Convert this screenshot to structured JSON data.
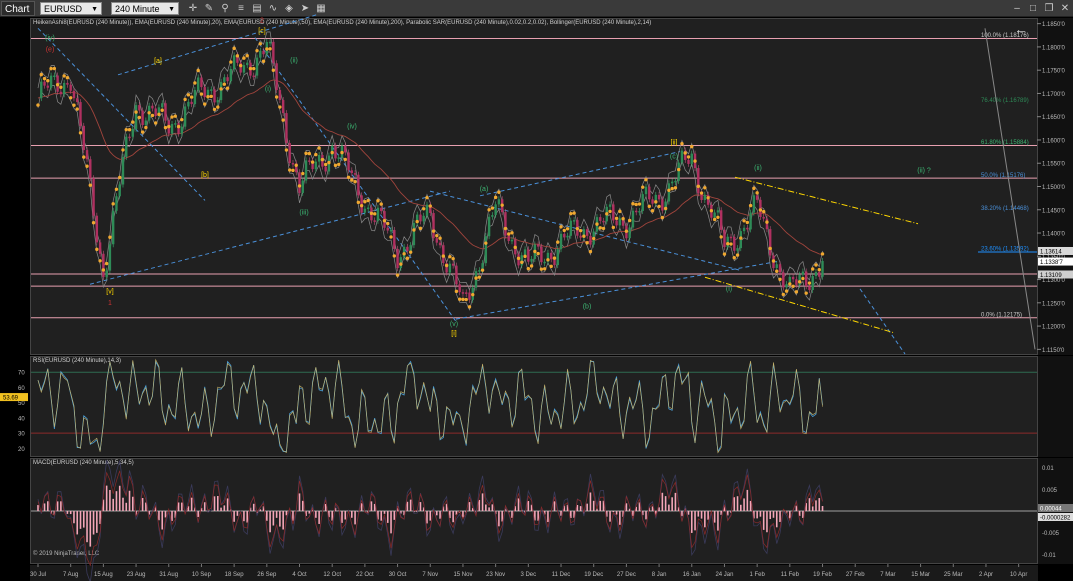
{
  "toolbar": {
    "chart_label": "Chart",
    "instrument": "EURUSD",
    "timeframe": "240 Minute",
    "back_icon": "left-arrow-icon",
    "icons": [
      "crosshair-icon",
      "draw-icon",
      "zoom-icon",
      "properties-icon",
      "template-icon",
      "indicator-icon",
      "strategy-icon",
      "pointer-icon",
      "bar-type-icon"
    ]
  },
  "main_panel": {
    "title": "HeikenAshi8(EURUSD (240 Minute)), EMA(EURUSD (240 Minute),20), EMA(EURUSD (240 Minute),50), EMA(EURUSD (240 Minute),200), Parabolic SAR(EURUSD (240 Minute),0.02,0.2,0.02), Bollinger(EURUSD (240 Minute),2,14)",
    "price_ticks": [
      "1.1850'0",
      "1.1800'0",
      "1.1750'0",
      "1.1700'0",
      "1.1650'0",
      "1.1600'0",
      "1.1550'0",
      "1.1500'0",
      "1.1450'0",
      "1.1400'0",
      "1.1350'0",
      "1.1300'0",
      "1.1250'0",
      "1.1200'0",
      "1.1150'0"
    ],
    "price_flags": [
      {
        "label": "1.13614",
        "color": "#d8d8d8"
      },
      {
        "label": "1.1338'7",
        "color": "#ffffff"
      },
      {
        "label": "1.13109",
        "color": "#cfcfcf"
      }
    ],
    "fib_levels": [
      {
        "label": "100.0% (1.18176)",
        "color": "#cccccc"
      },
      {
        "label": "76.40% (1.16789)",
        "color": "#2e8b57"
      },
      {
        "label": "61.80% (1.15884)",
        "color": "#3cb371"
      },
      {
        "label": "50.0% (1.15176)",
        "color": "#4a90d9"
      },
      {
        "label": "38.20% (1.14468)",
        "color": "#4a90d9"
      },
      {
        "label": "23.60% (1.13592)",
        "color": "#1e90ff"
      },
      {
        "label": "0.0% (1.12175)",
        "color": "#cccccc"
      }
    ],
    "wave_labels": [
      {
        "text": "(iv)",
        "color": "#3cb371"
      },
      {
        "text": "(e)",
        "color": "#cc3333"
      },
      {
        "text": "[a]",
        "color": "#ffd700"
      },
      {
        "text": "[c]",
        "color": "#ffd700"
      },
      {
        "text": "2",
        "color": "#cc3333"
      },
      {
        "text": "(ii)",
        "color": "#3cb371"
      },
      {
        "text": "(i)",
        "color": "#3cb371"
      },
      {
        "text": "(iv)",
        "color": "#3cb371"
      },
      {
        "text": "[b]",
        "color": "#ffd700"
      },
      {
        "text": "(iii)",
        "color": "#3cb371"
      },
      {
        "text": "[v]",
        "color": "#ffd700"
      },
      {
        "text": "1",
        "color": "#cc3333"
      },
      {
        "text": "(a)",
        "color": "#3cb371"
      },
      {
        "text": "(v)",
        "color": "#3cb371"
      },
      {
        "text": "[i]",
        "color": "#ffd700"
      },
      {
        "text": "[ii]",
        "color": "#ffd700"
      },
      {
        "text": "(c)",
        "color": "#3cb371"
      },
      {
        "text": "(b)",
        "color": "#3cb371"
      },
      {
        "text": "(ii)",
        "color": "#3cb371"
      },
      {
        "text": "(i)",
        "color": "#3cb371"
      },
      {
        "text": "(ii) ?",
        "color": "#3cb371"
      }
    ]
  },
  "rsi_panel": {
    "title": "RSI(EURUSD (240 Minute),14,3)",
    "ticks": [
      "70",
      "60",
      "50",
      "40",
      "30",
      "20"
    ],
    "current_value": "53.69"
  },
  "macd_panel": {
    "title": "MACD(EURUSD (240 Minute),5,34,5)",
    "ticks": [
      "0.01",
      "0.005",
      "-0.005",
      "-0.01"
    ],
    "current_values": [
      "0.00044",
      "-0.0000282"
    ]
  },
  "x_axis": {
    "labels": [
      "30 Jul",
      "7 Aug",
      "15 Aug",
      "23 Aug",
      "31 Aug",
      "10 Sep",
      "18 Sep",
      "26 Sep",
      "4 Oct",
      "12 Oct",
      "22 Oct",
      "30 Oct",
      "7 Nov",
      "15 Nov",
      "23 Nov",
      "3 Dec",
      "11 Dec",
      "19 Dec",
      "27 Dec",
      "8 Jan",
      "16 Jan",
      "24 Jan",
      "1 Feb",
      "11 Feb",
      "19 Feb",
      "27 Feb",
      "7 Mar",
      "15 Mar",
      "25 Mar",
      "2 Apr",
      "10 Apr"
    ]
  },
  "copyright": "© 2019 NinjaTrader, LLC",
  "chart_data": {
    "type": "line",
    "x": [
      "30 Jul",
      "7 Aug",
      "15 Aug",
      "23 Aug",
      "31 Aug",
      "10 Sep",
      "18 Sep",
      "26 Sep",
      "4 Oct",
      "12 Oct",
      "22 Oct",
      "30 Oct",
      "7 Nov",
      "15 Nov",
      "23 Nov",
      "3 Dec",
      "11 Dec",
      "19 Dec",
      "27 Dec",
      "8 Jan",
      "16 Jan",
      "24 Jan",
      "1 Feb",
      "11 Feb",
      "19 Feb"
    ],
    "series": [
      {
        "name": "HeikenAshi8(EURUSD (240 Minute))",
        "values": [
          1.169,
          1.174,
          1.132,
          1.168,
          1.163,
          1.17,
          1.174,
          1.18,
          1.15,
          1.159,
          1.147,
          1.136,
          1.144,
          1.124,
          1.145,
          1.133,
          1.138,
          1.142,
          1.143,
          1.148,
          1.156,
          1.137,
          1.145,
          1.127,
          1.134
        ]
      }
    ],
    "ylim": [
      1.114,
      1.186
    ],
    "rsi": {
      "ylim": [
        15,
        80
      ],
      "levels": [
        70,
        30
      ],
      "last": 53.69
    },
    "macd": {
      "ylim": [
        -0.012,
        0.012
      ]
    },
    "grid": false
  }
}
